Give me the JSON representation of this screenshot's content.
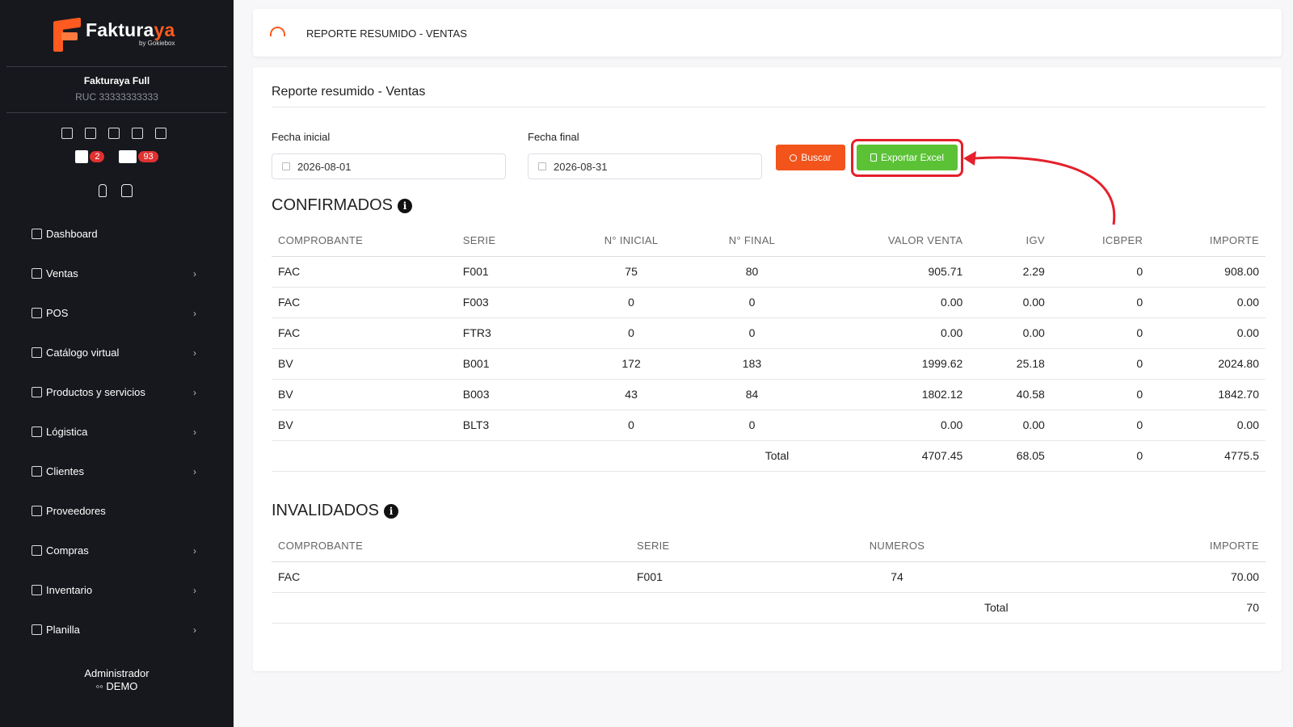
{
  "brand": {
    "name_main": "Faktura",
    "name_accent": "ya",
    "byline": "by Gokiebox"
  },
  "company": {
    "name": "Fakturaya Full",
    "ruc": "RUC 33333333333"
  },
  "badges": [
    {
      "icon": "calendar-x-icon",
      "count": "2"
    },
    {
      "icon": "box-icon",
      "count": "93"
    }
  ],
  "nav": [
    {
      "label": "Dashboard",
      "icon": "dashboard-icon",
      "chevron": false
    },
    {
      "label": "Ventas",
      "icon": "receipt-icon",
      "chevron": true
    },
    {
      "label": "POS",
      "icon": "monitor-icon",
      "chevron": true
    },
    {
      "label": "Catálogo virtual",
      "icon": "store-icon",
      "chevron": true
    },
    {
      "label": "Productos y servicios",
      "icon": "package-icon",
      "chevron": true
    },
    {
      "label": "Lógistica",
      "icon": "tag-icon",
      "chevron": true
    },
    {
      "label": "Clientes",
      "icon": "users-icon",
      "chevron": true
    },
    {
      "label": "Proveedores",
      "icon": "briefcase-icon",
      "chevron": false
    },
    {
      "label": "Compras",
      "icon": "shopping-bag-icon",
      "chevron": true
    },
    {
      "label": "Inventario",
      "icon": "clipboard-icon",
      "chevron": true
    },
    {
      "label": "Planilla",
      "icon": "id-badge-icon",
      "chevron": true
    }
  ],
  "admin": {
    "role": "Administrador",
    "user": "DEMO"
  },
  "topbar": {
    "title": "REPORTE RESUMIDO - VENTAS"
  },
  "card": {
    "title": "Reporte resumido - Ventas"
  },
  "filters": {
    "start_label": "Fecha inicial",
    "start_value": "2026-08-01",
    "end_label": "Fecha final",
    "end_value": "2026-08-31",
    "search_button": "Buscar",
    "export_button": "Exportar Excel"
  },
  "confirmados": {
    "title": "CONFIRMADOS",
    "headers": [
      "COMPROBANTE",
      "SERIE",
      "N° INICIAL",
      "N° FINAL",
      "VALOR VENTA",
      "IGV",
      "ICBPER",
      "IMPORTE"
    ],
    "rows": [
      [
        "FAC",
        "F001",
        "75",
        "80",
        "905.71",
        "2.29",
        "0",
        "908.00"
      ],
      [
        "FAC",
        "F003",
        "0",
        "0",
        "0.00",
        "0.00",
        "0",
        "0.00"
      ],
      [
        "FAC",
        "FTR3",
        "0",
        "0",
        "0.00",
        "0.00",
        "0",
        "0.00"
      ],
      [
        "BV",
        "B001",
        "172",
        "183",
        "1999.62",
        "25.18",
        "0",
        "2024.80"
      ],
      [
        "BV",
        "B003",
        "43",
        "84",
        "1802.12",
        "40.58",
        "0",
        "1842.70"
      ],
      [
        "BV",
        "BLT3",
        "0",
        "0",
        "0.00",
        "0.00",
        "0",
        "0.00"
      ]
    ],
    "total": {
      "label": "Total",
      "valor_venta": "4707.45",
      "igv": "68.05",
      "icbper": "0",
      "importe": "4775.5"
    }
  },
  "invalidados": {
    "title": "INVALIDADOS",
    "headers": [
      "COMPROBANTE",
      "SERIE",
      "NUMEROS",
      "IMPORTE"
    ],
    "rows": [
      [
        "FAC",
        "F001",
        "74",
        "70.00"
      ]
    ],
    "total": {
      "label": "Total",
      "importe": "70"
    }
  },
  "colors": {
    "accent": "#ff5a1f",
    "export_green": "#5bc236",
    "highlight_red": "#e5202b",
    "sidebar_bg": "#16181d"
  }
}
